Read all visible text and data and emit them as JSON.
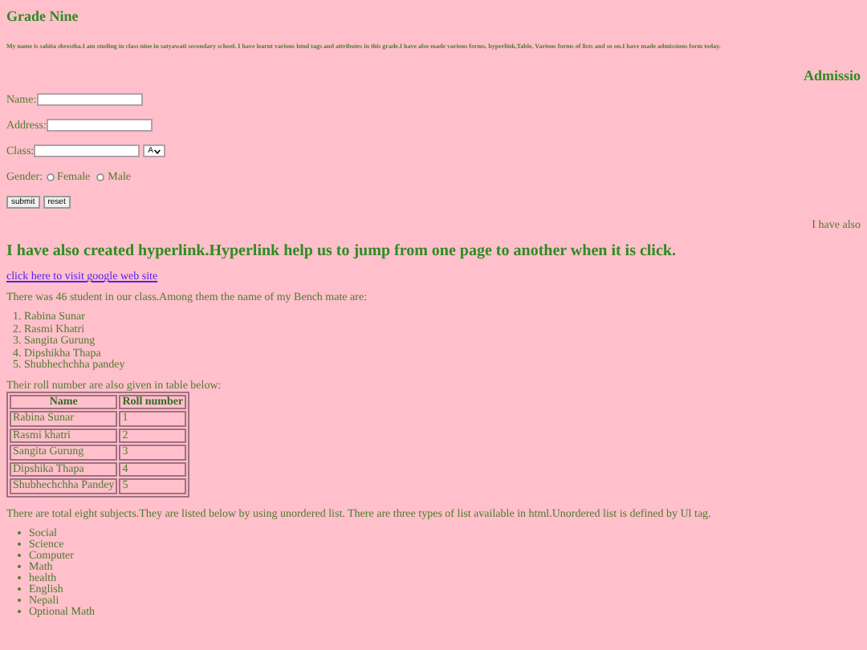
{
  "title": "Grade Nine",
  "intro": "My name is sabita shrestha.I am studing in class nine in satyawati secondary school. I have learnt various html tags and attributes in this grade.I have also made various forms, hyperlink,Table, Various forms of lists and so on.I have made admissions form today.",
  "scrolling_heading": "Admissio",
  "form": {
    "fields": [
      {
        "kind": "text",
        "label": "Name:"
      },
      {
        "kind": "text",
        "label": "Address:"
      },
      {
        "kind": "select",
        "label": "Class:",
        "value": "A"
      }
    ],
    "gender": {
      "label": "Gender:",
      "options": [
        {
          "label": "Female",
          "selected": false
        },
        {
          "label": "Male",
          "selected": false
        }
      ]
    },
    "buttons": [
      "submit",
      "reset"
    ]
  },
  "scrolling_text": "I have also",
  "hyperlink_heading": "I have also created hyperlink.Hyperlink help us to jump from one page to another when it is click.",
  "link": "click here to visit google web site",
  "bench_intro": "There was 46 student in our class.Among them the name of my Bench mate are:",
  "bench_mates": [
    {
      "number": "1.",
      "name": "Rabina Sunar"
    },
    {
      "number": "2.",
      "name": "Rasmi Khatri"
    },
    {
      "number": "3.",
      "name": "Sangita Gurung"
    },
    {
      "number": "4.",
      "name": "Dipshikha Thapa"
    },
    {
      "number": "5.",
      "name": "Shubhechchha pandey"
    }
  ],
  "table_intro": "Their roll number are also given in table below:",
  "table": {
    "columns": [
      "Name",
      "Roll number"
    ],
    "rows": [
      [
        "Rabina Sunar",
        "1"
      ],
      [
        "Rasmi khatri",
        "2"
      ],
      [
        "Sangita Gurung",
        "3"
      ],
      [
        "Dipshika Thapa",
        "4"
      ],
      [
        "Shubhechchha Pandey",
        "5"
      ]
    ]
  },
  "subjects_intro": "There are total eight subjects.They are listed below by using unordered list. There are three types of list available in html.Unordered list is defined by Ul tag.",
  "subjects": [
    "Social",
    "Science",
    "Computer",
    "Math",
    "health",
    "English",
    "Nepali",
    "Optional Math"
  ]
}
